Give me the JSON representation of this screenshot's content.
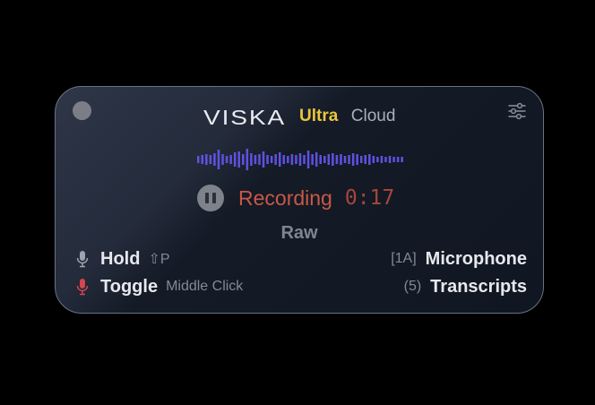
{
  "app": {
    "brand": "VISKA",
    "tier": "Ultra",
    "mode": "Cloud"
  },
  "icons": {
    "close": "window-close-dot",
    "settings": "sliders-icon",
    "pause": "pause-icon",
    "microphone": "microphone-icon"
  },
  "recording": {
    "status": "Recording",
    "timer": "0:17"
  },
  "output_mode": "Raw",
  "shortcuts": {
    "hold": {
      "label": "Hold",
      "key": "⇧P"
    },
    "toggle": {
      "label": "Toggle",
      "key": "Middle Click"
    }
  },
  "selectors": {
    "microphone": {
      "key": "[1A]",
      "label": "Microphone"
    },
    "transcripts": {
      "key": "(5)",
      "label": "Transcripts"
    }
  },
  "colors": {
    "tier": "#e9c63d",
    "recording": "#c95846",
    "toggle_mic": "#d2464e",
    "waveform_start": "#7f45d6",
    "waveform_end": "#2d63e0"
  }
}
